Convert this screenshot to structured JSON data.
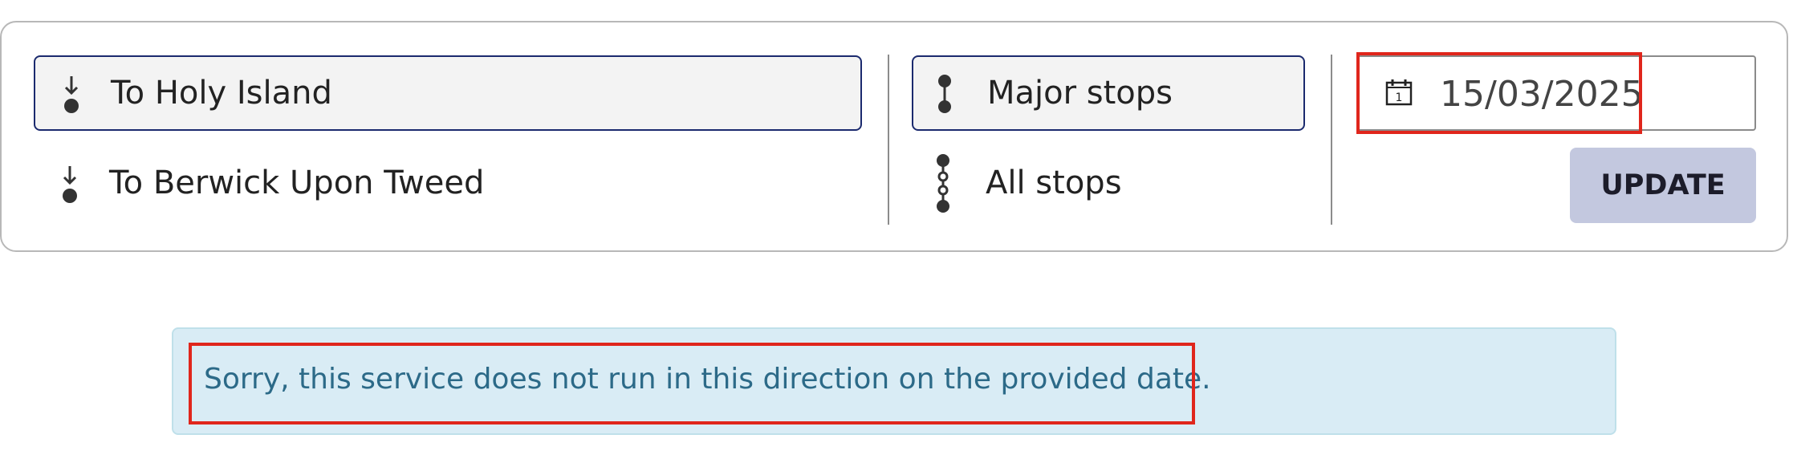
{
  "direction": {
    "options": [
      {
        "label": "To Holy Island",
        "icon": "arrow-down-dot-icon",
        "selected": true
      },
      {
        "label": "To Berwick Upon Tweed",
        "icon": "arrow-down-dot-icon",
        "selected": false
      }
    ]
  },
  "stops": {
    "options": [
      {
        "label": "Major stops",
        "icon": "major-stops-icon",
        "selected": true
      },
      {
        "label": "All stops",
        "icon": "all-stops-icon",
        "selected": false
      }
    ]
  },
  "date": {
    "value": "15/03/2025",
    "icon": "calendar-icon"
  },
  "update_button": {
    "label": "UPDATE"
  },
  "alert": {
    "message": "Sorry, this service does not run in this direction on the provided date."
  },
  "colors": {
    "selected_border": "#1b2a6e",
    "highlight": "#e0261c",
    "alert_background": "#d9ecf5",
    "alert_text": "#2c6a88",
    "button_background": "#c3c8df"
  }
}
